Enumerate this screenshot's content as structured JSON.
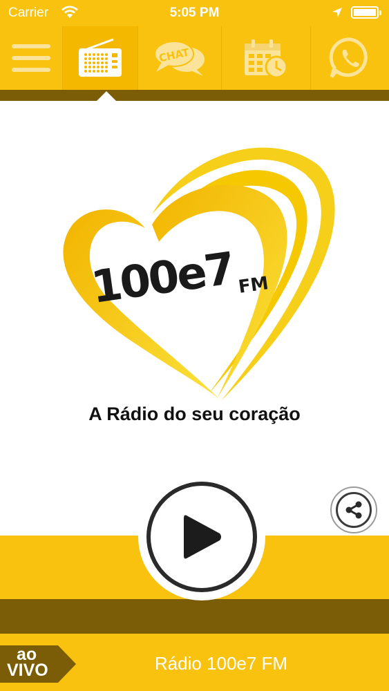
{
  "status_bar": {
    "carrier": "Carrier",
    "time": "5:05 PM"
  },
  "tabs": [
    {
      "name": "menu",
      "icon": "hamburger-menu-icon"
    },
    {
      "name": "radio",
      "icon": "radio-icon",
      "active": true
    },
    {
      "name": "chat",
      "icon": "chat-icon",
      "label": "CHAT"
    },
    {
      "name": "schedule",
      "icon": "calendar-clock-icon"
    },
    {
      "name": "whatsapp",
      "icon": "whatsapp-icon"
    }
  ],
  "logo": {
    "brand": "100e7",
    "brand_suffix": "FM",
    "tagline": "A Rádio do seu coração"
  },
  "player": {
    "play_icon": "play-icon",
    "share_icon": "share-icon",
    "live_label_top": "ao",
    "live_label_bottom": "VIVO",
    "station_name": "Rádio 100e7 FM"
  },
  "colors": {
    "accent": "#f8c20e",
    "dark_band": "#7a5d06",
    "heart_yellow": "#f6c400",
    "text_dark": "#1a1a1a"
  }
}
